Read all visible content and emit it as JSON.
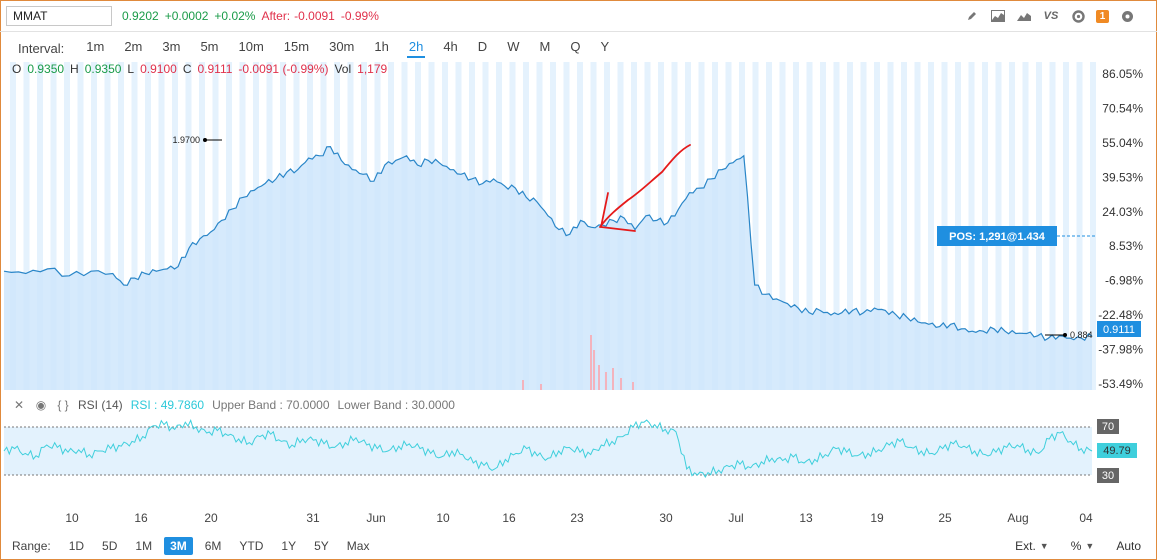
{
  "symbol": "MMAT",
  "quote": {
    "price": "0.9202",
    "change": "+0.0002",
    "change_pct": "+0.02%",
    "after_label": "After:",
    "after_change": "-0.0091",
    "after_pct": "-0.99%"
  },
  "toolbar_icons": [
    "pencil-icon",
    "chart-area-icon",
    "mountain-icon",
    "vs-compare",
    "gear-icon",
    "notification-badge-icon"
  ],
  "toolbar": {
    "vs_label": "VS",
    "badge_count": "1"
  },
  "interval": {
    "label": "Interval:",
    "items": [
      "1m",
      "2m",
      "3m",
      "5m",
      "10m",
      "15m",
      "30m",
      "1h",
      "2h",
      "4h",
      "D",
      "W",
      "M",
      "Q",
      "Y"
    ],
    "active": "2h"
  },
  "ohlc": {
    "o_label": "O",
    "o": "0.9350",
    "h_label": "H",
    "h": "0.9350",
    "l_label": "L",
    "l": "0.9100",
    "c_label": "C",
    "c": "0.9111",
    "chg": "-0.0091 (-0.99%)",
    "vol_label": "Vol",
    "vol": "1,179"
  },
  "colors": {
    "accent": "#1f8fe0",
    "up": "#1a9b48",
    "down": "#e0314b",
    "line": "#2a86c8",
    "area": "#cfe6fb",
    "rsi": "#3fcfdc",
    "annotation": "#e51a1a",
    "badge": "#f08a24"
  },
  "chart_data": [
    {
      "type": "area",
      "yscale": "percent",
      "ylim_pct": [
        -53.49,
        86.05
      ],
      "y_ticks": [
        "86.05%",
        "70.54%",
        "55.04%",
        "39.53%",
        "24.03%",
        "8.53%",
        "-6.98%",
        "-22.48%",
        "-37.98%",
        "-53.49%"
      ],
      "x_ticks": [
        "10",
        "16",
        "20",
        "31",
        "Jun",
        "10",
        "16",
        "23",
        "30",
        "Jul",
        "13",
        "19",
        "25",
        "Aug",
        "04"
      ],
      "high_label": "1.9700",
      "low_label": "0.884",
      "last_price": "0.9111",
      "position_label": "POS:  1,291@1.434",
      "series_pct": [
        [
          0,
          -2
        ],
        [
          2,
          -3
        ],
        [
          4,
          -1
        ],
        [
          6,
          -4
        ],
        [
          8,
          -2
        ],
        [
          10,
          -3
        ],
        [
          11,
          -8
        ],
        [
          12,
          -5
        ],
        [
          13,
          -3
        ],
        [
          14,
          -2
        ],
        [
          15,
          -1
        ],
        [
          16,
          0
        ],
        [
          17,
          8
        ],
        [
          18,
          12
        ],
        [
          19,
          15
        ],
        [
          20,
          20
        ],
        [
          21,
          25
        ],
        [
          22,
          30
        ],
        [
          23,
          33
        ],
        [
          24,
          36
        ],
        [
          25,
          38
        ],
        [
          26,
          41
        ],
        [
          27,
          42
        ],
        [
          28,
          47
        ],
        [
          29,
          48
        ],
        [
          30,
          52
        ],
        [
          31,
          46
        ],
        [
          32,
          42
        ],
        [
          33,
          40
        ],
        [
          34,
          37
        ],
        [
          35,
          44
        ],
        [
          36,
          46
        ],
        [
          37,
          48
        ],
        [
          38,
          44
        ],
        [
          39,
          46
        ],
        [
          40,
          45
        ],
        [
          41,
          42
        ],
        [
          42,
          40
        ],
        [
          43,
          38
        ],
        [
          44,
          36
        ],
        [
          45,
          38
        ],
        [
          46,
          35
        ],
        [
          47,
          34
        ],
        [
          48,
          30
        ],
        [
          49,
          28
        ],
        [
          50,
          22
        ],
        [
          51,
          16
        ],
        [
          52,
          14
        ],
        [
          53,
          20
        ],
        [
          54,
          17
        ],
        [
          55,
          18
        ],
        [
          56,
          20
        ],
        [
          57,
          21
        ],
        [
          58,
          16
        ],
        [
          59,
          22
        ],
        [
          60,
          20
        ],
        [
          61,
          19
        ],
        [
          62,
          25
        ],
        [
          63,
          32
        ],
        [
          64,
          34
        ],
        [
          65,
          38
        ],
        [
          66,
          42
        ],
        [
          67,
          45
        ],
        [
          68,
          48
        ],
        [
          69,
          -8
        ],
        [
          70,
          -12
        ],
        [
          71,
          -14
        ],
        [
          72,
          -16
        ],
        [
          73,
          -18
        ],
        [
          74,
          -20
        ],
        [
          75,
          -19
        ],
        [
          76,
          -21
        ],
        [
          77,
          -20
        ],
        [
          78,
          -19
        ],
        [
          79,
          -20
        ],
        [
          80,
          -18
        ],
        [
          81,
          -19
        ],
        [
          82,
          -21
        ],
        [
          83,
          -22
        ],
        [
          84,
          -24
        ],
        [
          85,
          -25
        ],
        [
          86,
          -26
        ],
        [
          87,
          -25
        ],
        [
          88,
          -27
        ],
        [
          89,
          -28
        ],
        [
          90,
          -28
        ],
        [
          91,
          -27
        ],
        [
          92,
          -28
        ],
        [
          93,
          -29
        ],
        [
          94,
          -29
        ],
        [
          95,
          -30
        ],
        [
          96,
          -31
        ],
        [
          97,
          -30
        ],
        [
          98,
          -31
        ],
        [
          99,
          -31
        ],
        [
          100,
          -30
        ]
      ]
    },
    {
      "type": "line",
      "name": "RSI (14)",
      "value_label": "RSI : 49.7860",
      "upper_band_label": "Upper Band : 70.0000",
      "lower_band_label": "Lower Band : 30.0000",
      "upper_band": 70,
      "lower_band": 30,
      "current": "49.79",
      "ylim": [
        20,
        80
      ],
      "series": [
        50,
        52,
        48,
        46,
        55,
        53,
        49,
        51,
        47,
        50,
        52,
        54,
        58,
        62,
        71,
        72,
        68,
        74,
        70,
        65,
        67,
        63,
        60,
        57,
        62,
        64,
        58,
        55,
        60,
        59,
        56,
        53,
        57,
        61,
        55,
        52,
        50,
        54,
        56,
        52,
        48,
        45,
        50,
        47,
        40,
        38,
        35,
        43,
        48,
        52,
        46,
        44,
        50,
        53,
        49,
        47,
        55,
        58,
        62,
        70,
        74,
        72,
        68,
        66,
        35,
        30,
        32,
        34,
        37,
        39,
        36,
        41,
        44,
        42,
        45,
        40,
        43,
        47,
        52,
        49,
        46,
        48,
        51,
        55,
        58,
        53,
        50,
        48,
        52,
        56,
        54,
        50,
        47,
        49,
        53,
        55,
        51,
        48,
        60,
        65,
        58,
        52,
        50
      ]
    }
  ]
}
